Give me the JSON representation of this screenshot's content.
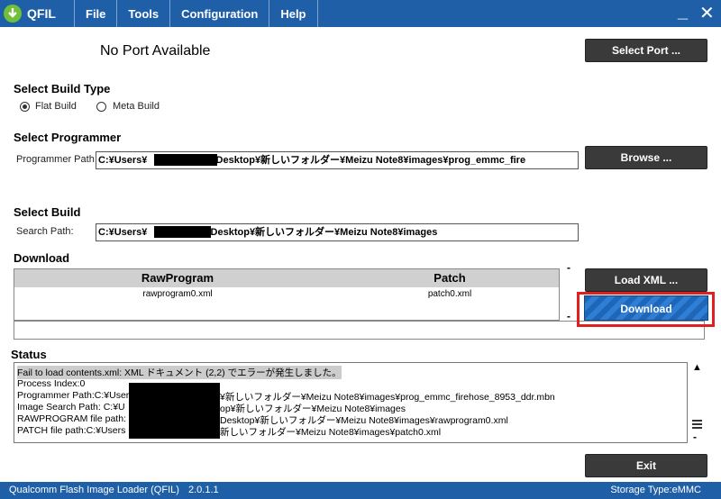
{
  "window": {
    "app_name": "QFIL",
    "minimize": "_",
    "close": "✕"
  },
  "menu": [
    "File",
    "Tools",
    "Configuration",
    "Help"
  ],
  "port": {
    "status": "No Port Available",
    "select_button": "Select Port ..."
  },
  "build_type": {
    "heading": "Select Build Type",
    "options": [
      {
        "label": "Flat Build",
        "selected": true
      },
      {
        "label": "Meta Build",
        "selected": false
      }
    ]
  },
  "programmer": {
    "heading": "Select Programmer",
    "path_label": "Programmer Path",
    "path_prefix": "C:¥Users¥",
    "path_suffix": "¥Desktop¥新しいフォルダー¥Meizu Note8¥images¥prog_emmc_fire",
    "browse_button": "Browse ..."
  },
  "select_build": {
    "heading": "Select Build",
    "search_label": "Search Path:",
    "path_prefix": "C:¥Users¥",
    "path_suffix": "¥Desktop¥新しいフォルダー¥Meizu Note8¥images"
  },
  "download": {
    "heading": "Download",
    "columns": [
      "RawProgram",
      "Patch"
    ],
    "rows": [
      [
        "rawprogram0.xml",
        "patch0.xml"
      ]
    ],
    "load_xml_button": "Load XML ...",
    "download_button": "Download",
    "dash": "-"
  },
  "status": {
    "heading": "Status",
    "lines": [
      "Fail to load contents.xml: XML ドキュメント (2,2) でエラーが発生しました。",
      "Process Index:0",
      "Programmer Path:C:¥User",
      "Image Search Path: C:¥U",
      "RAWPROGRAM file path:",
      "PATCH file path:C:¥Users"
    ],
    "lines_tail": [
      "",
      "",
      "¥新しいフォルダー¥Meizu Note8¥images¥prog_emmc_firehose_8953_ddr.mbn",
      "op¥新しいフォルダー¥Meizu Note8¥images",
      "Desktop¥新しいフォルダー¥Meizu Note8¥images¥rawprogram0.xml",
      "新しいフォルダー¥Meizu Note8¥images¥patch0.xml"
    ],
    "scroll_up": "▲",
    "dash": "-"
  },
  "exit_button": "Exit",
  "footer": {
    "app_full_name": "Qualcomm Flash Image Loader (QFIL)",
    "version": "2.0.1.1",
    "storage": "Storage Type:eMMC"
  }
}
